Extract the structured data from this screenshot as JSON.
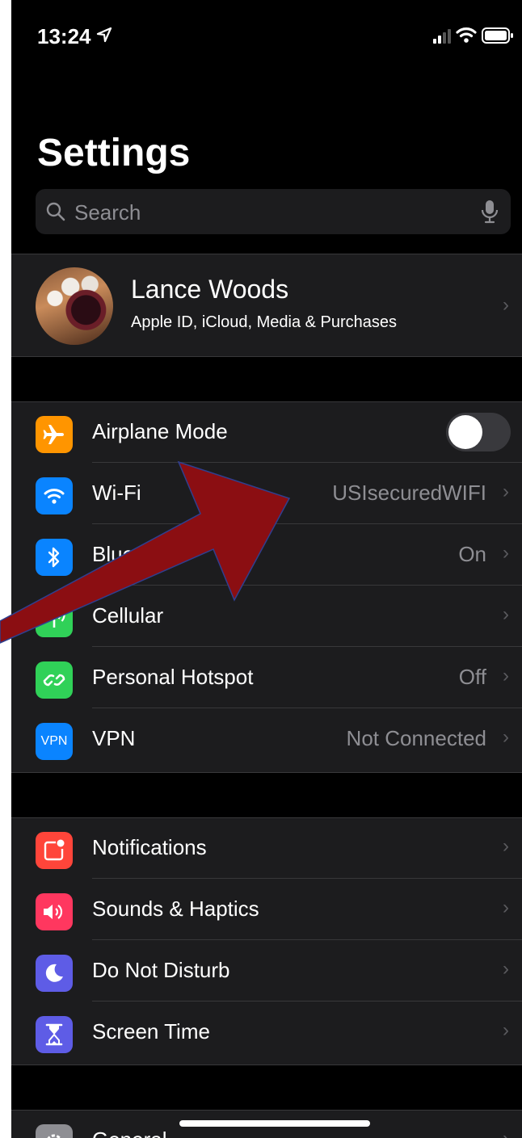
{
  "status_bar": {
    "time": "13:24"
  },
  "header": {
    "title": "Settings"
  },
  "search": {
    "placeholder": "Search"
  },
  "profile": {
    "name": "Lance Woods",
    "subtitle": "Apple ID, iCloud, Media & Purchases"
  },
  "network": [
    {
      "label": "Airplane Mode",
      "value": "",
      "icon": "airplane-icon",
      "color": "#ff9500",
      "toggle": false
    },
    {
      "label": "Wi-Fi",
      "value": "USIsecuredWIFI",
      "icon": "wifi-icon",
      "color": "#0a84ff"
    },
    {
      "label": "Bluetooth",
      "value": "On",
      "icon": "bluetooth-icon",
      "color": "#0a84ff"
    },
    {
      "label": "Cellular",
      "value": "",
      "icon": "antenna-icon",
      "color": "#30d158"
    },
    {
      "label": "Personal Hotspot",
      "value": "Off",
      "icon": "hotspot-icon",
      "color": "#30d158"
    },
    {
      "label": "VPN",
      "value": "Not Connected",
      "icon": "vpn-icon",
      "icon_text": "VPN",
      "color": "#0a84ff"
    }
  ],
  "alerts": [
    {
      "label": "Notifications",
      "icon": "notification-icon",
      "color": "#ff453a"
    },
    {
      "label": "Sounds & Haptics",
      "icon": "speaker-icon",
      "color": "#ff375f"
    },
    {
      "label": "Do Not Disturb",
      "icon": "moon-icon",
      "color": "#5e5ce6"
    },
    {
      "label": "Screen Time",
      "icon": "hourglass-icon",
      "color": "#5e5ce6"
    }
  ],
  "general": [
    {
      "label": "General",
      "icon": "gear-icon",
      "color": "#8e8e93"
    }
  ],
  "annotation": {
    "color": "#8b0e12",
    "outline": "#2f3f8f"
  }
}
